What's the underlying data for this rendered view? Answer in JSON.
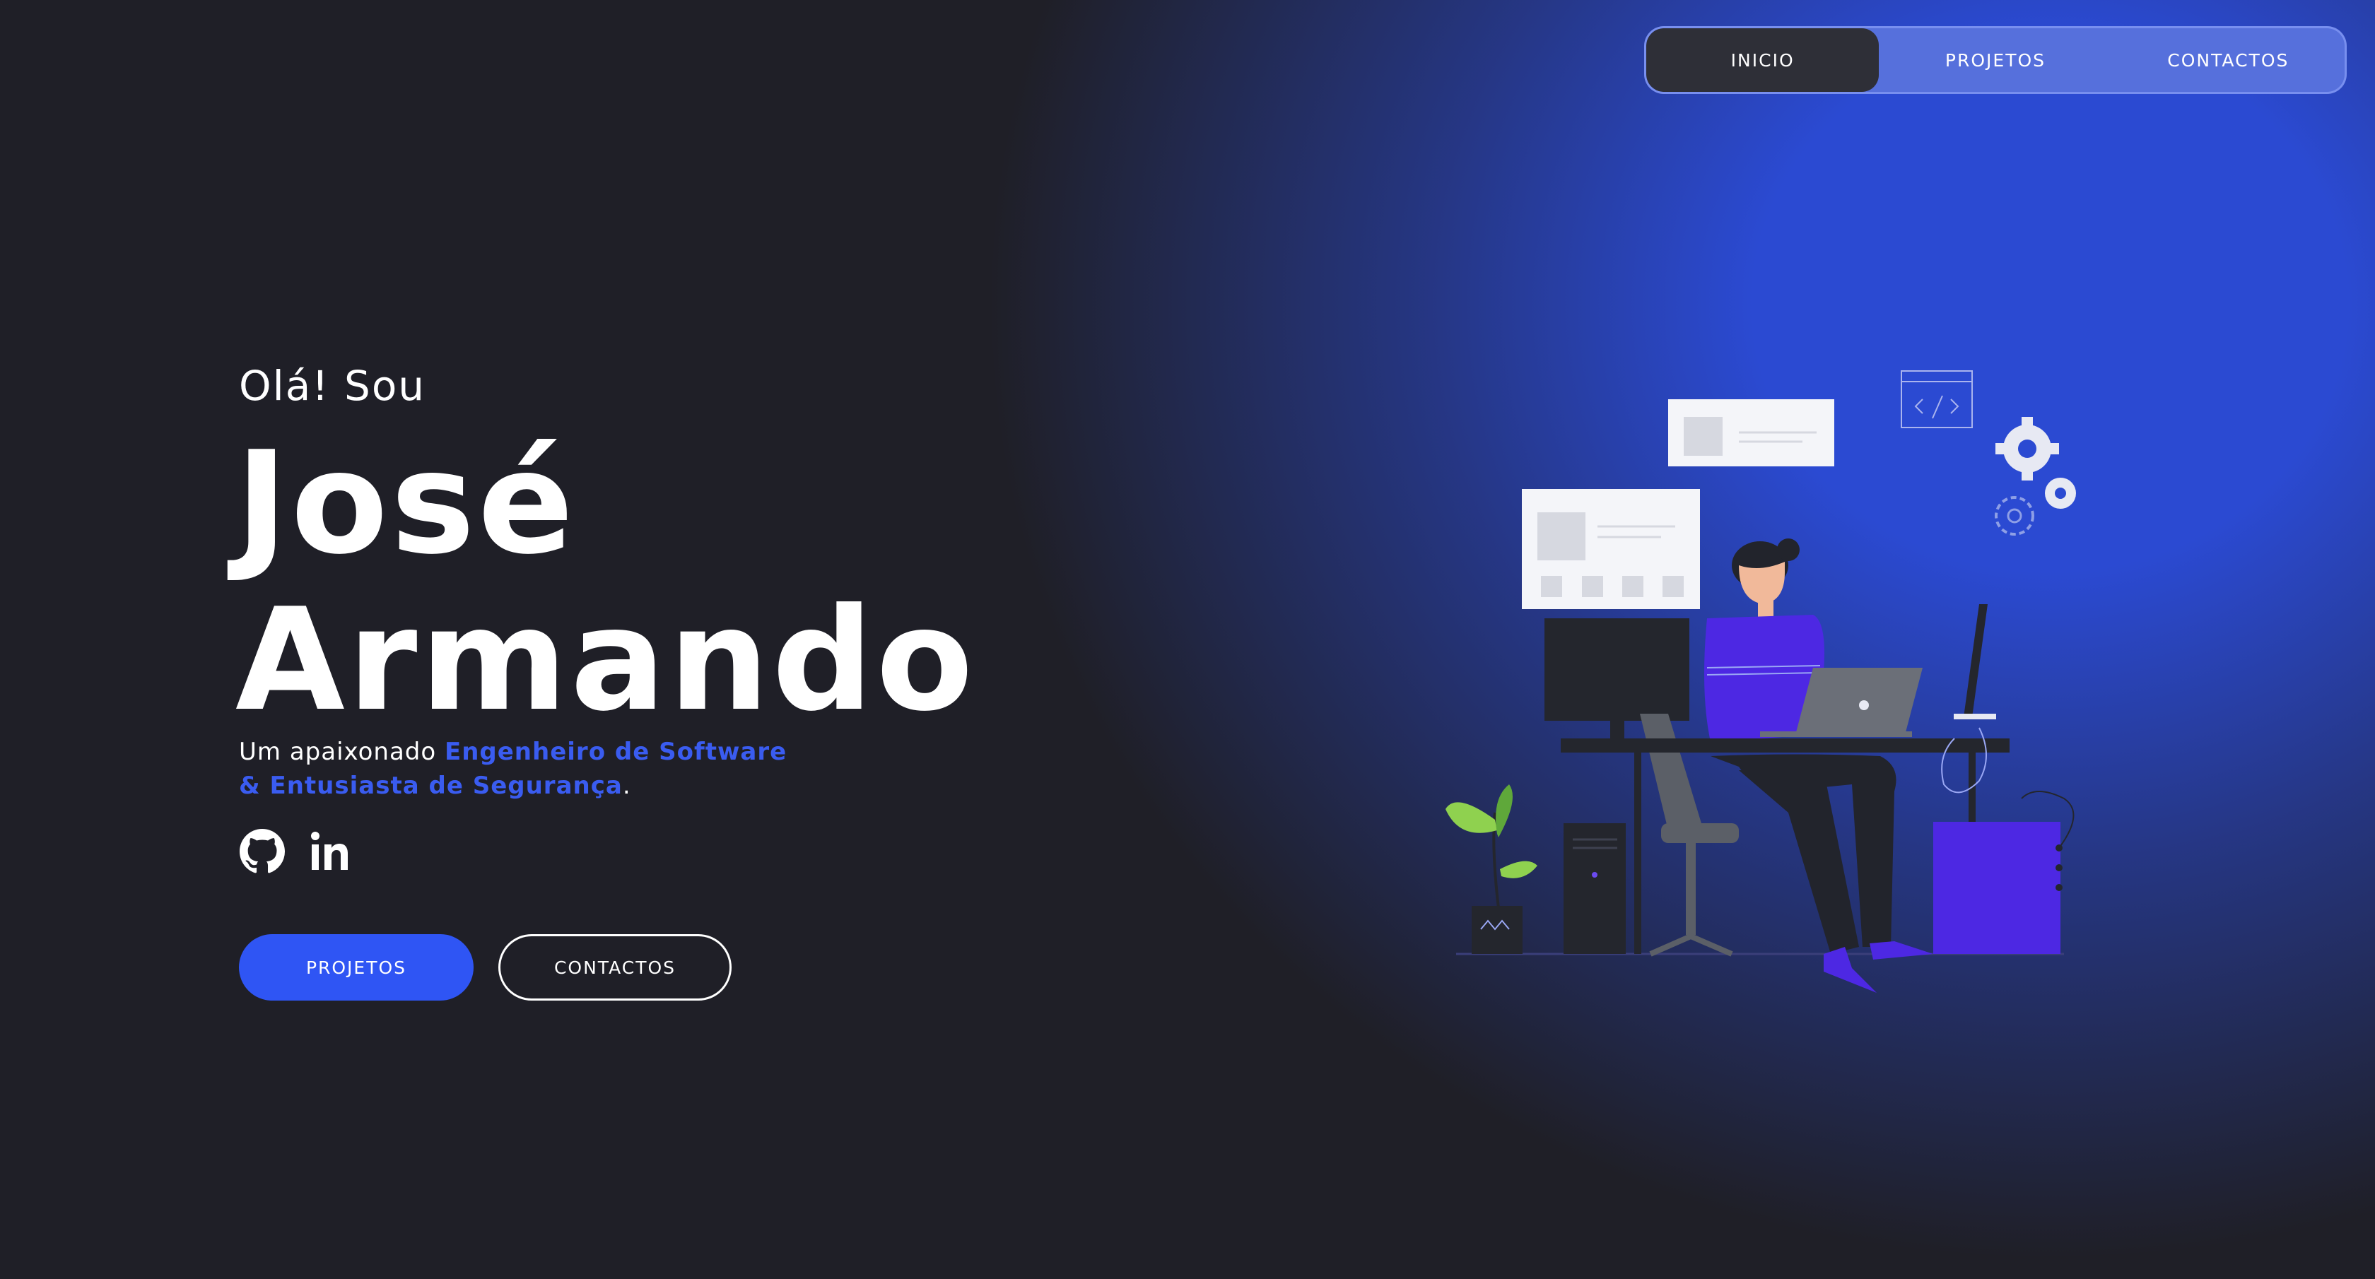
{
  "nav": {
    "items": [
      {
        "label": "INICIO",
        "active": true
      },
      {
        "label": "PROJETOS",
        "active": false
      },
      {
        "label": "CONTACTOS",
        "active": false
      }
    ]
  },
  "hero": {
    "greeting": "Olá! Sou",
    "name_line1": "José",
    "name_line2": "Armando",
    "tagline_prefix": "Um apaixonado ",
    "tagline_highlight1": "Engenheiro de Software",
    "tagline_highlight2": "& Entusiasta de Segurança",
    "tagline_suffix": ".",
    "buttons": {
      "primary": "PROJETOS",
      "secondary": "CONTACTOS"
    }
  },
  "socials": [
    {
      "icon": "github-icon"
    },
    {
      "icon": "linkedin-icon"
    }
  ],
  "colors": {
    "background": "#1f1f27",
    "accent": "#2f55f4",
    "highlight": "#3a5cf0",
    "glow": "#2b4ad2",
    "nav_active": "#2e2f37"
  }
}
